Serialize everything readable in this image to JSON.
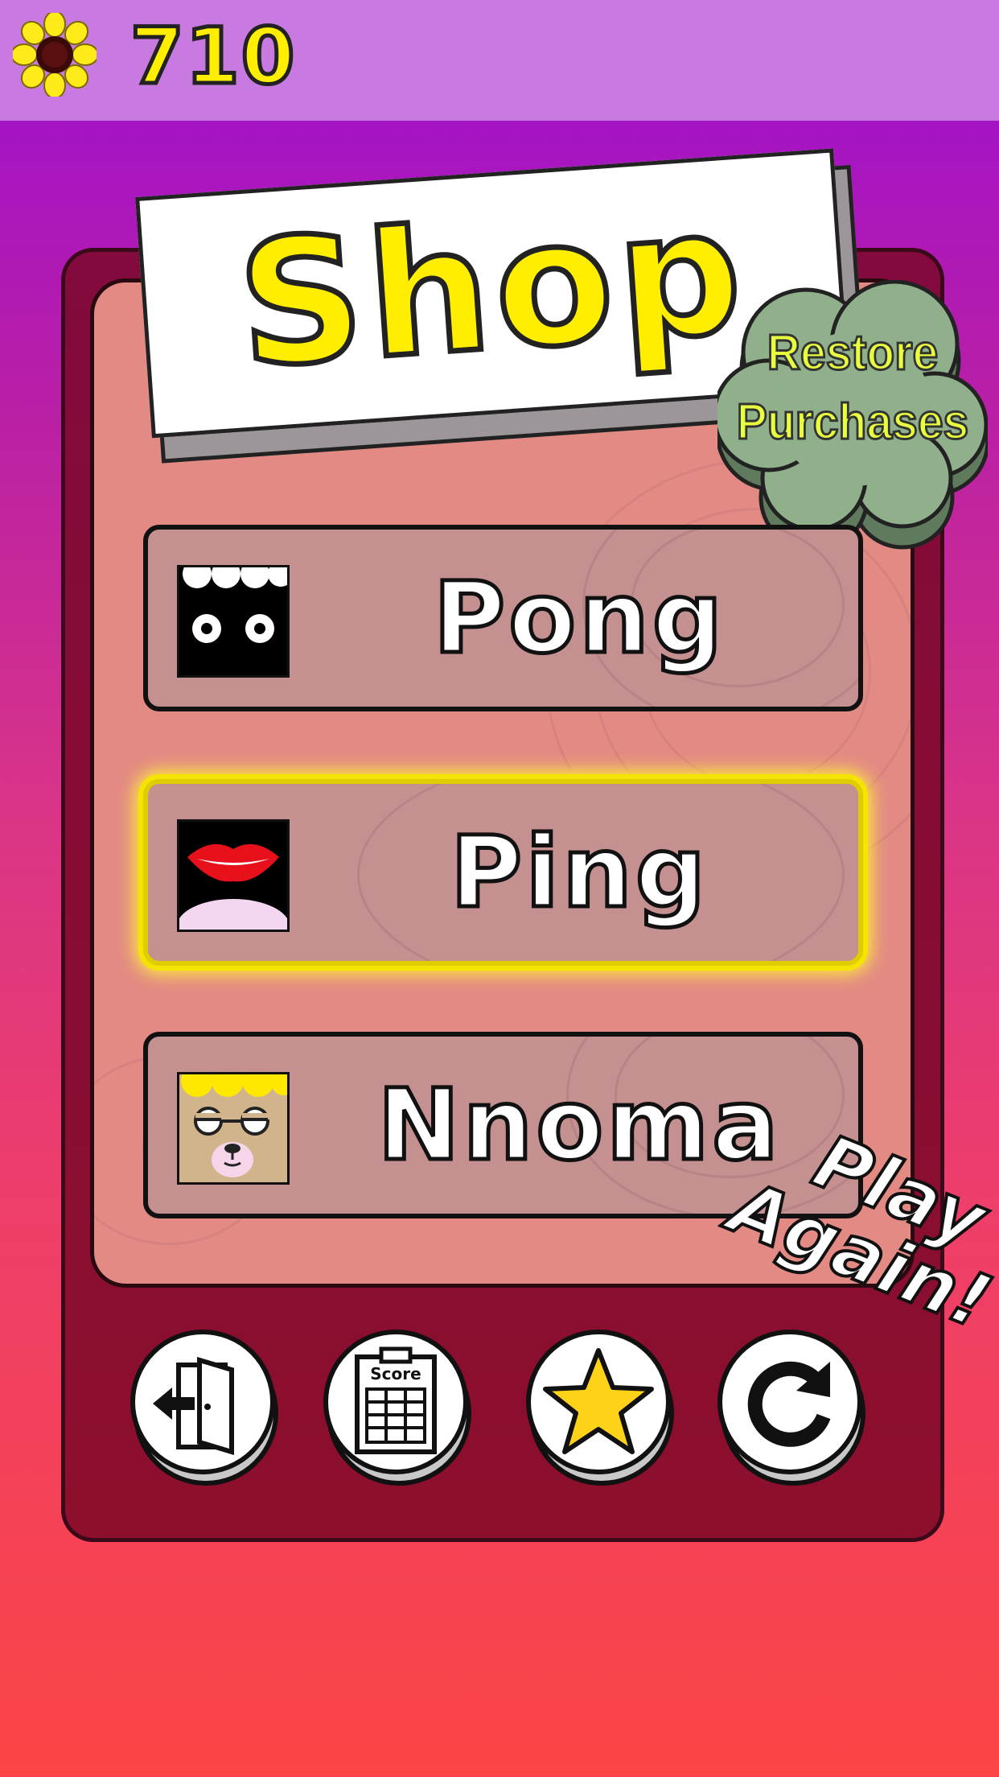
{
  "top_bar": {
    "currency_icon": "sunflower-icon",
    "coin_count": "710"
  },
  "title": "Shop",
  "restore_button": {
    "label_line1": "Restore",
    "label_line2": "Purchases"
  },
  "characters": [
    {
      "name": "Pong",
      "icon": "pong-character-icon",
      "selected": false
    },
    {
      "name": "Ping",
      "icon": "ping-character-icon",
      "selected": true
    },
    {
      "name": "Nnoma",
      "icon": "nnoma-character-icon",
      "selected": false
    }
  ],
  "play_again": {
    "line1": "Play",
    "line2": "Again!"
  },
  "bottom_buttons": [
    {
      "icon": "exit-door-icon"
    },
    {
      "icon": "scoreboard-icon",
      "label": "Score"
    },
    {
      "icon": "star-icon"
    },
    {
      "icon": "restart-icon"
    }
  ],
  "colors": {
    "accent_yellow": "#ffee00",
    "selected_glow": "#f5e300",
    "restore_green": "#8fb08a"
  }
}
